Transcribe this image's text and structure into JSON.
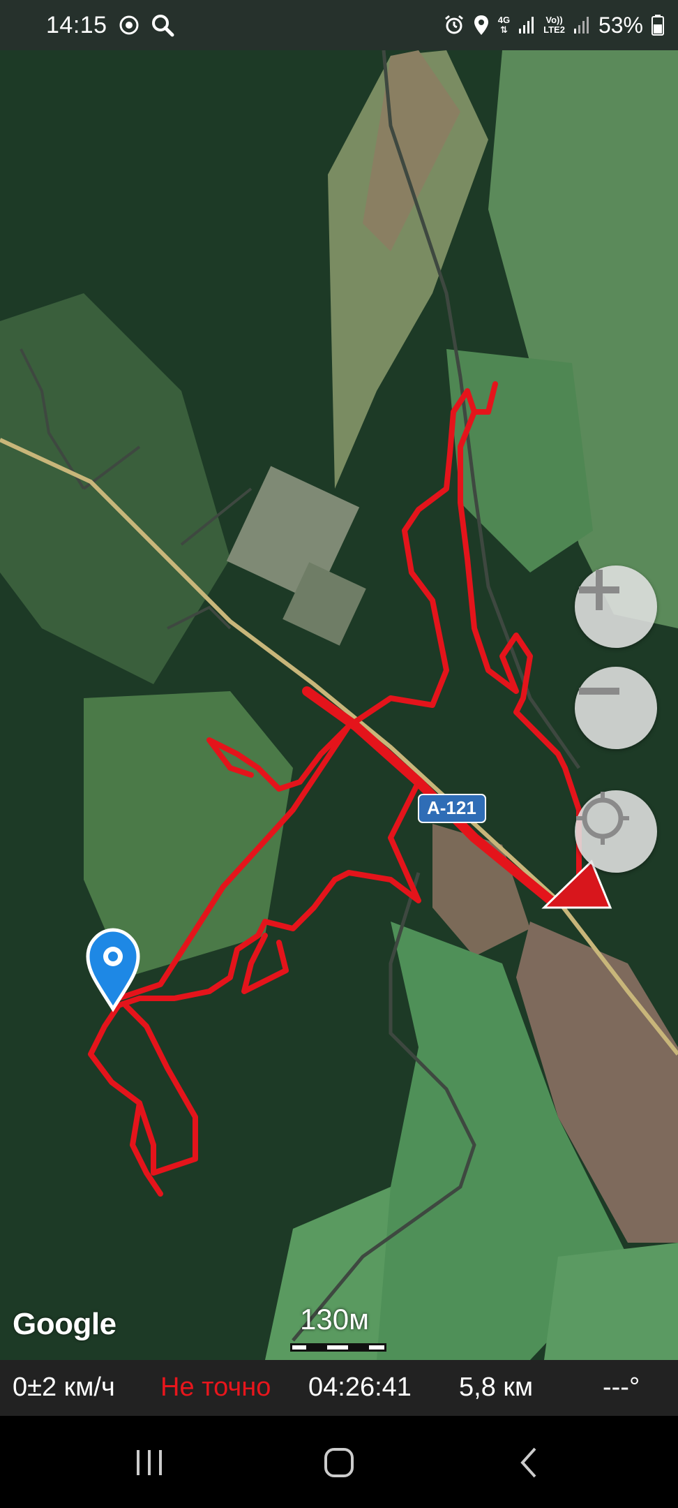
{
  "status_bar": {
    "time": "14:15",
    "network_top": "4G",
    "volte_top": "Vo))",
    "volte_bottom": "LTE2",
    "battery": "53%"
  },
  "map": {
    "road_label": "A-121",
    "provider_logo": "Google",
    "scale_label": "130м",
    "colors": {
      "track": "#e4141b",
      "road": "#c8b67a",
      "marker": "#1e88e5"
    },
    "controls": {
      "zoom_in_icon": "plus-icon",
      "zoom_out_icon": "minus-icon",
      "locate_icon": "crosshair-icon"
    }
  },
  "info_bar": {
    "speed": "0±2 км/ч",
    "accuracy": "Не точно",
    "elapsed": "04:26:41",
    "distance": "5,8 км",
    "bearing": "---°",
    "accuracy_color": "#e8161c"
  },
  "nav_bar": {
    "recents_icon": "recents-icon",
    "home_icon": "home-icon",
    "back_icon": "back-icon"
  }
}
